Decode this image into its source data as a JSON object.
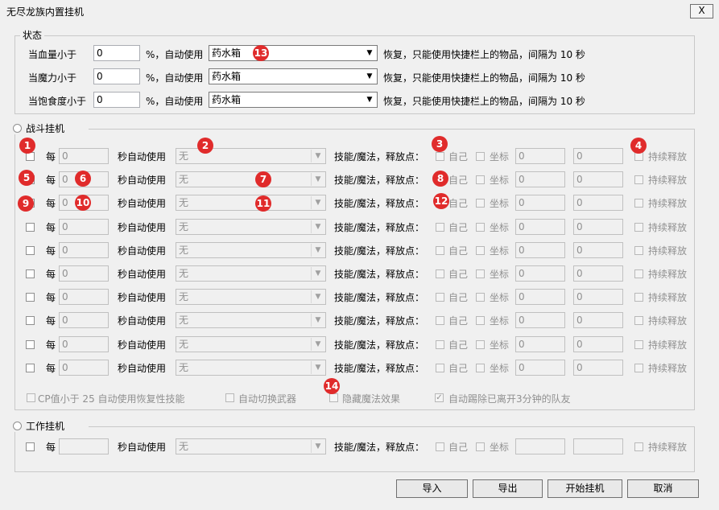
{
  "window": {
    "title": "无尽龙族内置挂机",
    "close_label": "X"
  },
  "status": {
    "legend": "状态",
    "rows": [
      {
        "label": "当血量小于",
        "value": "0",
        "percent_label": "%，自动使用",
        "item": "药水箱",
        "suffix": "恢复，只能使用快捷栏上的物品，间隔为 10 秒"
      },
      {
        "label": "当魔力小于",
        "value": "0",
        "percent_label": "%，自动使用",
        "item": "药水箱",
        "suffix": "恢复，只能使用快捷栏上的物品，间隔为 10 秒"
      },
      {
        "label": "当饱食度小于",
        "value": "0",
        "percent_label": "%，自动使用",
        "item": "药水箱",
        "suffix": "恢复，只能使用快捷栏上的物品，间隔为 10 秒"
      }
    ]
  },
  "battle": {
    "legend": "战斗挂机",
    "every_label": "每",
    "sec_label": "秒自动使用",
    "skill_label": "技能/魔法，释放点：",
    "self_label": "自己",
    "coord_label": "坐标",
    "sustain_label": "持续释放",
    "interval_value": "0",
    "skill_value": "无",
    "coord_x": "0",
    "coord_y": "0",
    "row_count": 10,
    "options": {
      "cp_label": "CP值小于 25 自动使用恢复性技能",
      "weapon_label": "自动切换武器",
      "hide_effect_label": "隐藏魔法效果",
      "kick_label": "自动踢除已离开3分钟的队友"
    }
  },
  "work": {
    "legend": "工作挂机",
    "every_label": "每",
    "sec_label": "秒自动使用",
    "skill_value": "无",
    "skill_label": "技能/魔法，释放点：",
    "self_label": "自己",
    "coord_label": "坐标",
    "sustain_label": "持续释放"
  },
  "buttons": {
    "import": "导入",
    "export": "导出",
    "start": "开始挂机",
    "cancel": "取消"
  },
  "annotations": [
    "1",
    "2",
    "3",
    "4",
    "5",
    "6",
    "7",
    "8",
    "9",
    "10",
    "11",
    "12",
    "13",
    "14"
  ]
}
